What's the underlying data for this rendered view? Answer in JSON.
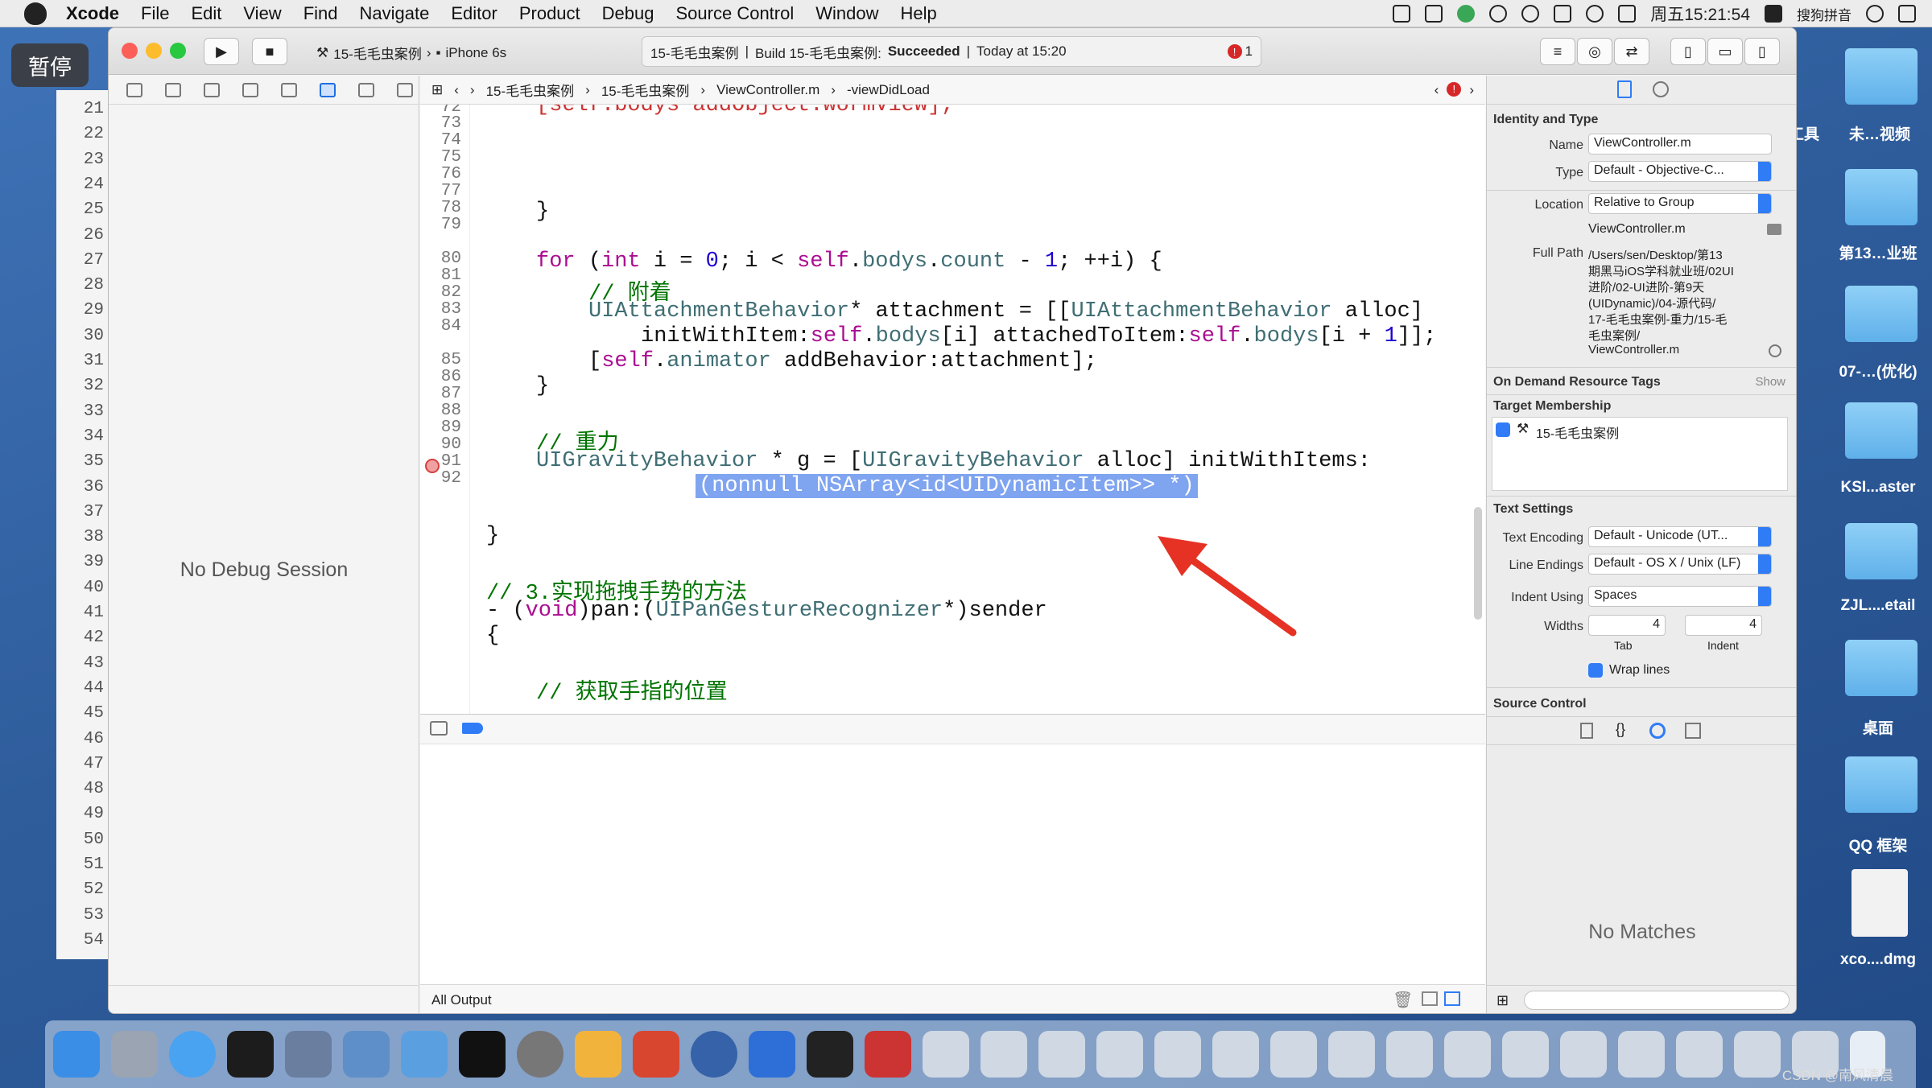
{
  "menubar": {
    "app": "Xcode",
    "items": [
      "File",
      "Edit",
      "View",
      "Find",
      "Navigate",
      "Editor",
      "Product",
      "Debug",
      "Source Control",
      "Window",
      "Help"
    ],
    "clock": "周五15:21:54",
    "ime": "搜狗拼音"
  },
  "overlay": {
    "pause": "暂停"
  },
  "toolbar": {
    "scheme": "15-毛毛虫案例",
    "device": "iPhone 6s",
    "status_project": "15-毛毛虫案例",
    "status_build": "Build 15-毛毛虫案例:",
    "status_result": "Succeeded",
    "status_time": "Today at 15:20",
    "error_count": "1"
  },
  "jumpbar": {
    "crumbs": [
      "15-毛毛虫案例",
      "15-毛毛虫案例",
      "ViewController.m",
      "-viewDidLoad"
    ]
  },
  "navigator": {
    "no_debug": "No Debug Session"
  },
  "gutter_lines": [
    "21",
    "22",
    "23",
    "24",
    "25",
    "26",
    "27",
    "28",
    "29",
    "30",
    "31",
    "32",
    "33",
    "34",
    "35",
    "36",
    "37",
    "38",
    "39",
    "40",
    "41",
    "42",
    "43",
    "44",
    "45",
    "46",
    "47",
    "48",
    "49",
    "50",
    "51",
    "52",
    "53",
    "54"
  ],
  "editor": {
    "line_numbers": [
      "72",
      "73",
      "74",
      "75",
      "76",
      "77",
      "78",
      "79",
      "",
      "80",
      "81",
      "82",
      "83",
      "84",
      "",
      "85",
      "86",
      "87",
      "88",
      "89",
      "90",
      "91",
      "92"
    ],
    "code": {
      "l72": "[self.bodys addObject:wormView];",
      "l75": "}",
      "l77a": "for",
      "l77b": "(",
      "l77c": "int",
      "l77d": " i = ",
      "l77e": "0",
      "l77f": "; i < ",
      "l77g": "self",
      "l77h": ".",
      "l77i": "bodys",
      "l77j": ".",
      "l77k": "count",
      "l77l": " - ",
      "l77m": "1",
      "l77n": "; ++i) {",
      "l78": "// 附着",
      "l79a": "UIAttachmentBehavior",
      "l79b": "* attachment = [[",
      "l79c": "UIAttachmentBehavior",
      "l79d": " alloc]",
      "l79e": "initWithItem:",
      "l79f": "self",
      "l79g": ".",
      "l79h": "bodys",
      "l79i": "[i] ",
      "l79j": "attachedToItem:",
      "l79k": "self",
      "l79l": ".",
      "l79m": "bodys",
      "l79n": "[i + ",
      "l79o": "1",
      "l79p": "]];",
      "l80a": "[",
      "l80b": "self",
      "l80c": ".",
      "l80d": "animator",
      "l80e": " addBehavior:attachment];",
      "l81": "}",
      "l83": "// 重力",
      "l84a": "UIGravityBehavior",
      "l84b": " * g = [",
      "l84c": "UIGravityBehavior",
      "l84d": " alloc] initWithItems:",
      "l84e": "(nonnull NSArray<id<UIDynamicItem>> *)",
      "l86": "}",
      "l88": "// 3.实现拖拽手势的方法",
      "l89a": "- (",
      "l89b": "void",
      "l89c": ")pan:(",
      "l89d": "UIPanGestureRecognizer",
      "l89e": "*)sender",
      "l90": "{",
      "l92": "// 获取手指的位置"
    }
  },
  "console": {
    "filter": "All Output"
  },
  "inspector": {
    "identity_header": "Identity and Type",
    "name_label": "Name",
    "name_value": "ViewController.m",
    "type_label": "Type",
    "type_value": "Default - Objective-C...",
    "location_label": "Location",
    "location_value": "Relative to Group",
    "location_file": "ViewController.m",
    "fullpath_label": "Full Path",
    "fullpath_lines": [
      "/Users/sen/Desktop/第13",
      "期黑马iOS学科就业班/02UI",
      "进阶/02-UI进阶-第9天",
      "(UIDynamic)/04-源代码/",
      "17-毛毛虫案例-重力/15-毛",
      "毛虫案例/",
      "ViewController.m"
    ],
    "odr_header": "On Demand Resource Tags",
    "odr_show": "Show",
    "target_header": "Target Membership",
    "target_name": "15-毛毛虫案例",
    "text_header": "Text Settings",
    "encoding_label": "Text Encoding",
    "encoding_value": "Default - Unicode (UT...",
    "endings_label": "Line Endings",
    "endings_value": "Default - OS X / Unix (LF)",
    "indent_label": "Indent Using",
    "indent_value": "Spaces",
    "widths_label": "Widths",
    "tab_value": "4",
    "indent_value_num": "4",
    "tab_caption": "Tab",
    "indent_caption": "Indent",
    "wrap_label": "Wrap lines",
    "sc_header": "Source Control",
    "no_matches": "No Matches"
  },
  "desktop": {
    "labels": [
      "工具",
      "未…视频",
      "第13…业班",
      "07-…(优化)",
      "KSI...aster",
      "ZJL....etail",
      "桌面",
      "QQ 框架",
      "xco....dmg"
    ]
  },
  "watermark": "CSDN @南风清晨"
}
